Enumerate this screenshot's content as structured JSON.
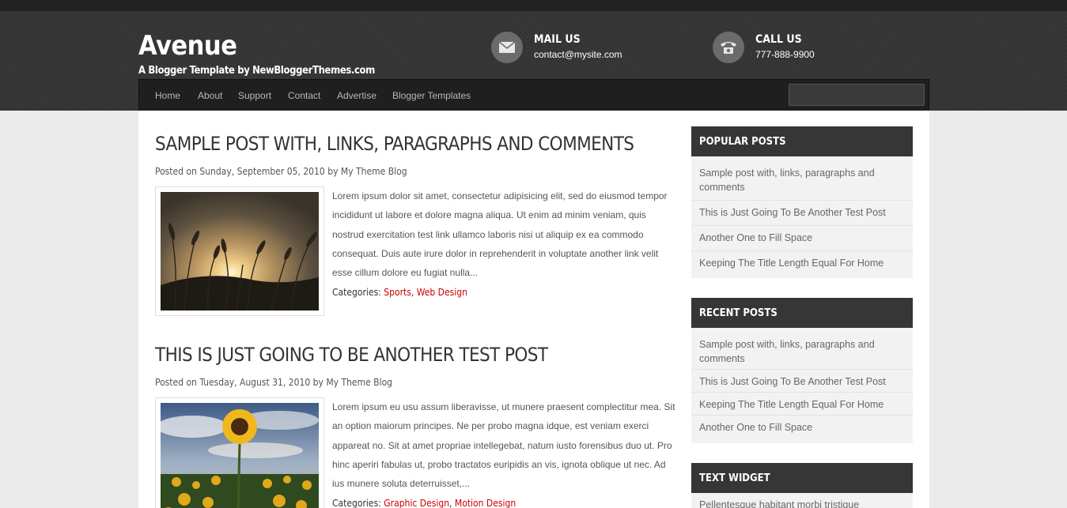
{
  "header": {
    "title": "Avenue",
    "description": "A Blogger Template by NewBloggerThemes.com",
    "mail": {
      "title": "MAIL US",
      "value": "contact@mysite.com",
      "icon": "envelope-icon"
    },
    "call": {
      "title": "CALL US",
      "value": "777-888-9900",
      "icon": "phone-icon"
    }
  },
  "nav": {
    "items": [
      "Home",
      "About",
      "Support",
      "Contact",
      "Advertise",
      "Blogger Templates"
    ],
    "search_placeholder": ""
  },
  "posts": [
    {
      "title": "SAMPLE POST WITH, LINKS, PARAGRAPHS AND COMMENTS",
      "meta_prefix": "Posted on",
      "date": "Sunday, September 05, 2010",
      "by": "by",
      "author": "My Theme Blog",
      "excerpt": "Lorem ipsum dolor sit amet, consectetur adipisicing elit, sed do eiusmod tempor incididunt ut labore et dolore magna aliqua. Ut enim ad minim veniam, quis nostrud exercitation test link ullamco laboris nisi ut aliquip ex ea commodo consequat. Duis aute irure dolor in reprehenderit in voluptate another link velit esse cillum dolore eu fugiat nulla...",
      "categories_label": "Categories:",
      "categories": [
        "Sports",
        "Web Design"
      ]
    },
    {
      "title": "THIS IS JUST GOING TO BE ANOTHER TEST POST",
      "meta_prefix": "Posted on",
      "date": "Tuesday, August 31, 2010",
      "by": "by",
      "author": "My Theme Blog",
      "excerpt": "Lorem ipsum eu usu assum liberavisse, ut munere praesent complectitur mea. Sit an option maiorum principes. Ne per probo magna idque, est veniam exerci appareat no. Sit at amet propriae intellegebat, natum iusto forensibus duo ut. Pro hinc aperiri fabulas ut, probo tractatos euripidis an vis, ignota oblique ut nec. Ad ius munere soluta deterruisset,...",
      "categories_label": "Categories:",
      "categories": [
        "Graphic Design",
        "Motion Design"
      ]
    }
  ],
  "sidebar": {
    "popular": {
      "title": "POPULAR POSTS",
      "items": [
        "Sample post with, links, paragraphs and comments",
        "This is Just Going To Be Another Test Post",
        "Another One to Fill Space",
        "Keeping The Title Length Equal For Home"
      ]
    },
    "recent": {
      "title": "RECENT POSTS",
      "items": [
        "Sample post with, links, paragraphs and comments",
        "This is Just Going To Be Another Test Post",
        "Keeping The Title Length Equal For Home",
        "Another One to Fill Space"
      ]
    },
    "text_widget": {
      "title": "TEXT WIDGET",
      "text": "Pellentesque habitant morbi tristique"
    }
  },
  "colors": {
    "header_bg": "#353535",
    "nav_bg": "#1f1f1f",
    "category_link": "#cc0000",
    "widget_title_bg": "#363636"
  }
}
